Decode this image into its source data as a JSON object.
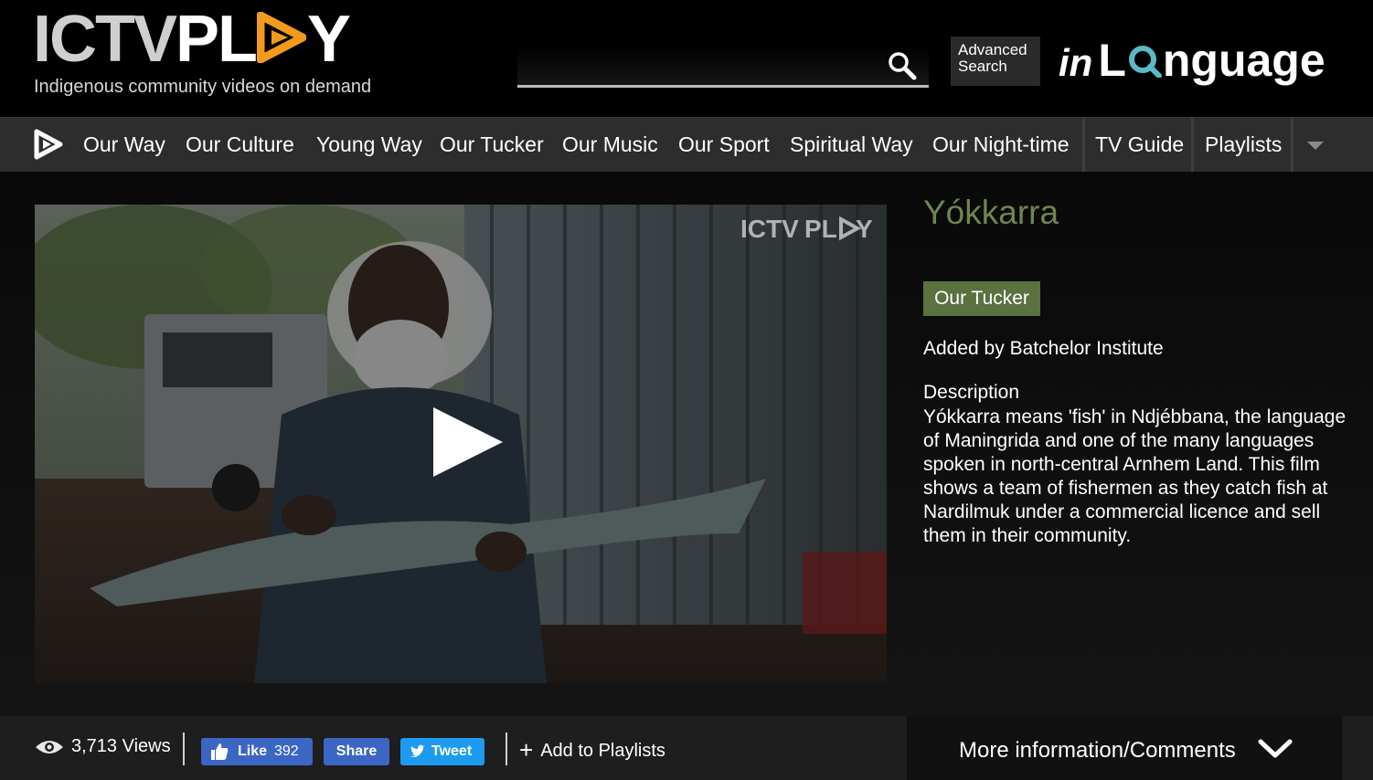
{
  "header": {
    "logo_text_ictv": "ICTV",
    "logo_text_pl": "PL",
    "logo_text_y": "Y",
    "tagline": "Indigenous community videos on demand",
    "search": {
      "value": "",
      "placeholder": ""
    },
    "advanced_search_line1": "Advanced",
    "advanced_search_line2": "Search",
    "inlanguage_in": "in",
    "inlanguage_l": "L",
    "inlanguage_rest": "nguage"
  },
  "nav": {
    "items": [
      "Our Way",
      "Our Culture",
      "Young Way",
      "Our Tucker",
      "Our Music",
      "Our Sport",
      "Spiritual Way",
      "Our Night-time",
      "TV Guide",
      "Playlists"
    ]
  },
  "video": {
    "watermark_ictv": "ICTV",
    "watermark_pl": "PL",
    "watermark_y": "Y"
  },
  "details": {
    "title": "Yókkarra",
    "category": "Our Tucker",
    "added_prefix": "Added by ",
    "added_by": "Batchelor Institute",
    "description_heading": "Description",
    "description": "Yókkarra means 'fish' in Ndjébbana, the language of Maningrida and one of the many languages spoken in north-central Arnhem Land. This film shows a team of fishermen as they catch fish at Nardilmuk under a commercial licence and sell them in their community."
  },
  "actions": {
    "views": "3,713 Views",
    "like_label": "Like",
    "like_count": "392",
    "share_label": "Share",
    "tweet_label": "Tweet",
    "add_to_playlists": "Add to Playlists",
    "more_info": "More information/Comments"
  },
  "colors": {
    "accent_orange": "#f29a1c",
    "title_green": "#6e8650",
    "category_green": "#5b7140",
    "facebook_blue": "#3b66c4",
    "twitter_blue": "#1d9bf0",
    "inlanguage_teal": "#5cb8c6"
  },
  "icons": {
    "search": "search-icon",
    "logo_play": "play-triangle-icon",
    "nav_home": "play-home-icon",
    "nav_more": "caret-down-icon",
    "video_play": "play-icon",
    "views": "eye-icon",
    "like": "thumbs-up-icon",
    "tweet": "twitter-bird-icon",
    "add": "plus-icon",
    "more": "chevron-down-icon"
  }
}
